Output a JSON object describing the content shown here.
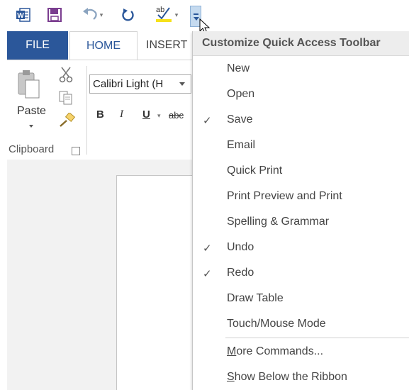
{
  "qat": {
    "icons": [
      "word-logo-icon",
      "save-icon",
      "undo-icon",
      "redo-icon",
      "spelling-icon",
      "customize-qat-icon"
    ],
    "colors": {
      "accent": "#2b579a",
      "save": "#7a3d8f",
      "undo": "#8aa3bf",
      "redo": "#2b579a",
      "highlight": "#f6e11a"
    }
  },
  "tabs": {
    "file": "FILE",
    "home": "HOME",
    "insert": "INSERT"
  },
  "ribbon": {
    "paste_label": "Paste",
    "clipboard_label": "Clipboard",
    "font_name": "Calibri Light (H",
    "bold": "B",
    "italic": "I",
    "underline": "U",
    "strikethrough": "abc"
  },
  "menu": {
    "title": "Customize Quick Access Toolbar",
    "items": [
      {
        "label": "New",
        "checked": false
      },
      {
        "label": "Open",
        "checked": false
      },
      {
        "label": "Save",
        "checked": true
      },
      {
        "label": "Email",
        "checked": false
      },
      {
        "label": "Quick Print",
        "checked": false
      },
      {
        "label": "Print Preview and Print",
        "checked": false
      },
      {
        "label": "Spelling & Grammar",
        "checked": false
      },
      {
        "label": "Undo",
        "checked": true
      },
      {
        "label": "Redo",
        "checked": true
      },
      {
        "label": "Draw Table",
        "checked": false
      },
      {
        "label": "Touch/Mouse Mode",
        "checked": false
      }
    ],
    "more_commands": {
      "mnemonic": "M",
      "rest": "ore Commands..."
    },
    "show_below": {
      "mnemonic": "S",
      "rest": "how Below the Ribbon"
    },
    "check_mark": "✓"
  }
}
